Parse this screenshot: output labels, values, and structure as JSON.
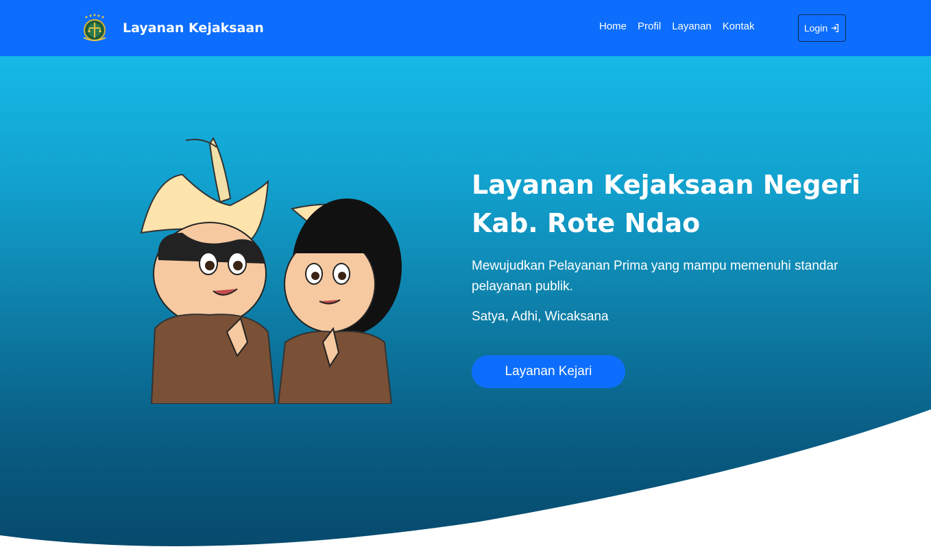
{
  "navbar": {
    "brand_name": "Layanan Kejaksaan",
    "brand_logo_icon": "kejaksaan-emblem-icon",
    "links": [
      {
        "label": "Home"
      },
      {
        "label": "Profil"
      },
      {
        "label": "Layanan"
      },
      {
        "label": "Kontak"
      }
    ],
    "login_label": "Login",
    "login_icon": "sign-in-icon",
    "background_color": "#0d6efd"
  },
  "hero": {
    "title": "Layanan Kejaksaan Negeri Kab. Rote Ndao",
    "description": "Mewujudkan Pelayanan Prima yang mampu memenuhi standar pelayanan publik.",
    "motto": "Satya, Adhi, Wicaksana",
    "button_label": "Layanan Kejari",
    "illustration": "mascot-couple-illustration",
    "gradient_top": "#17b9e6",
    "gradient_bottom": "#074a6d",
    "button_color": "#0d6efd"
  }
}
